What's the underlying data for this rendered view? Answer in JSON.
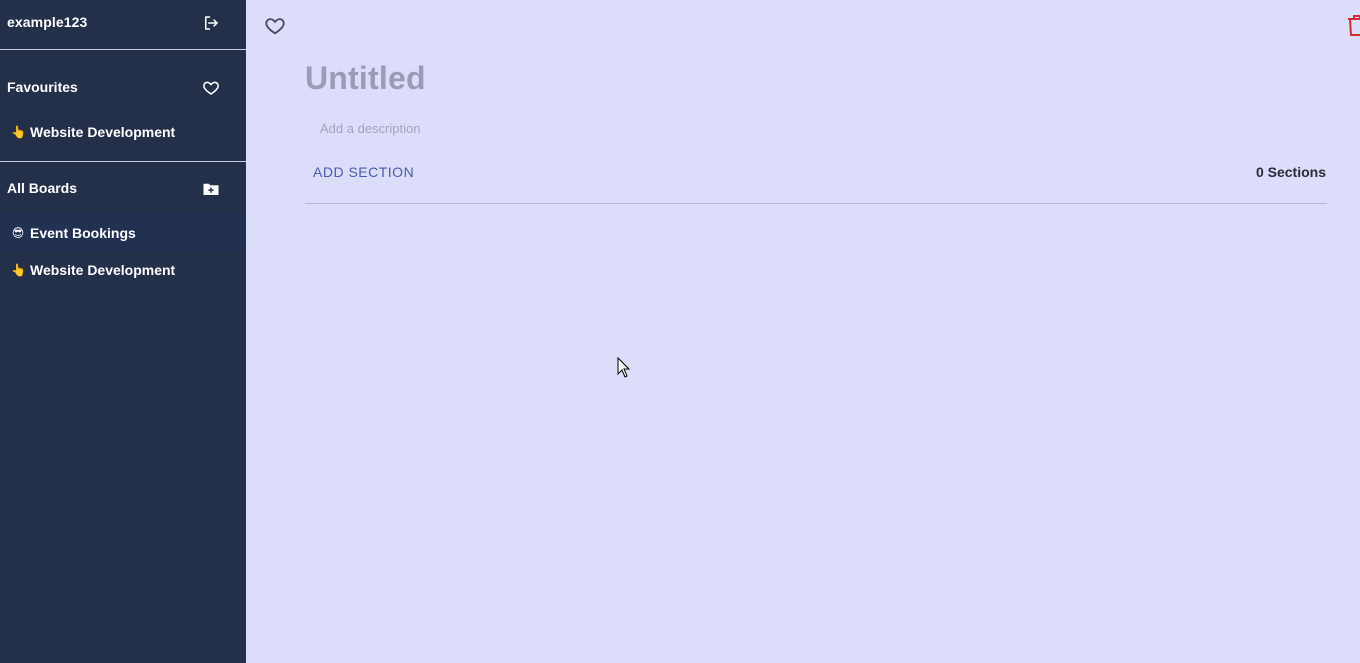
{
  "sidebar": {
    "username": "example123",
    "favourites": {
      "title": "Favourites",
      "items": [
        {
          "emoji": "👆",
          "label": "Website Development"
        }
      ]
    },
    "boards": {
      "title": "All Boards",
      "items": [
        {
          "emoji": "😎",
          "label": "Event Bookings",
          "active": true
        },
        {
          "emoji": "👆",
          "label": "Website Development",
          "active": false
        }
      ]
    },
    "icons": {
      "logout": "logout-icon",
      "favourite": "heart-icon",
      "add_board": "add-folder-icon"
    }
  },
  "main": {
    "title": "Untitled",
    "description_placeholder": "Add a description",
    "add_section_label": "ADD SECTION",
    "section_count": "0 Sections",
    "icons": {
      "favourite": "heart-outline-icon",
      "delete": "trash-icon"
    }
  },
  "colors": {
    "sidebar_bg": "#24304a",
    "main_bg": "#dcdcfb",
    "accent": "#4a5bb0",
    "delete": "#d32f2f"
  }
}
